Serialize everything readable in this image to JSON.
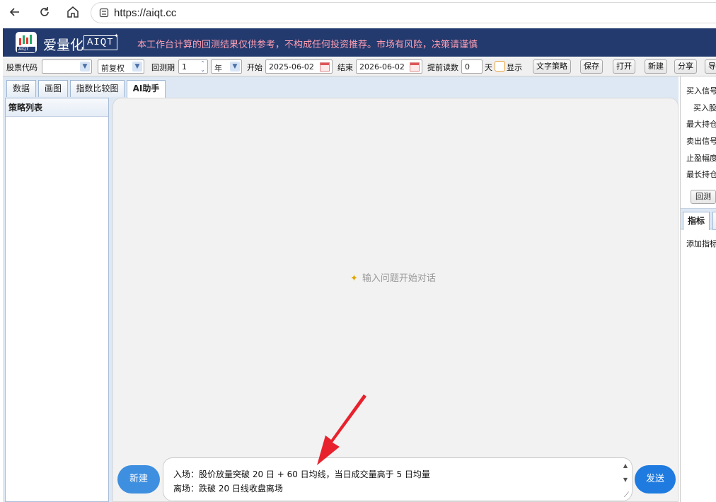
{
  "browser": {
    "url": "https://aiqt.cc"
  },
  "header": {
    "brand_cn": "爱量化",
    "brand_en": "AIQT",
    "logo_small": "AIQT",
    "disclaimer": "本工作台计算的回测结果仅供参考，不构成任何投资推荐。市场有风险，决策请谨慎"
  },
  "toolbar": {
    "stock_code_label": "股票代码",
    "stock_code_value": "",
    "adjust_value": "前复权",
    "period_label": "回测期",
    "period_value": "1",
    "period_unit": "年",
    "start_label": "开始",
    "start_date": "2025-06-02",
    "end_label": "结束",
    "end_date": "2026-06-02",
    "preread_label": "提前读数",
    "preread_value": "0",
    "preread_unit": "天",
    "show_label": "显示",
    "buttons": [
      "文字策略",
      "保存",
      "打开",
      "新建",
      "分享",
      "导"
    ]
  },
  "tabs": [
    {
      "label": "数据",
      "active": false
    },
    {
      "label": "画图",
      "active": false
    },
    {
      "label": "指数比较图",
      "active": false
    },
    {
      "label": "AI助手",
      "active": true
    }
  ],
  "strategy_list": {
    "title": "策略列表"
  },
  "chat": {
    "empty_hint": "输入问题开始对话",
    "new_label": "新建",
    "send_label": "发送",
    "input_lines": [
      "入场：股价放量突破 20 日 + 60 日均线，当日成交量高于 5 日均量",
      "离场：跌破 20 日线收盘离场"
    ]
  },
  "right_panel": {
    "lines": [
      "买入信号",
      "买入股",
      "最大持仓",
      "卖出信号",
      "止盈幅度",
      "最长持仓"
    ],
    "backtest_btn": "回测",
    "tab_label": "指标",
    "add_indicator": "添加指标"
  },
  "colors": {
    "header_bg": "#233a6e",
    "disclaimer": "#ff9fb3",
    "send_button": "#1f7be0",
    "new_button": "#3f8fe0",
    "annotation_arrow": "#e8222d"
  }
}
